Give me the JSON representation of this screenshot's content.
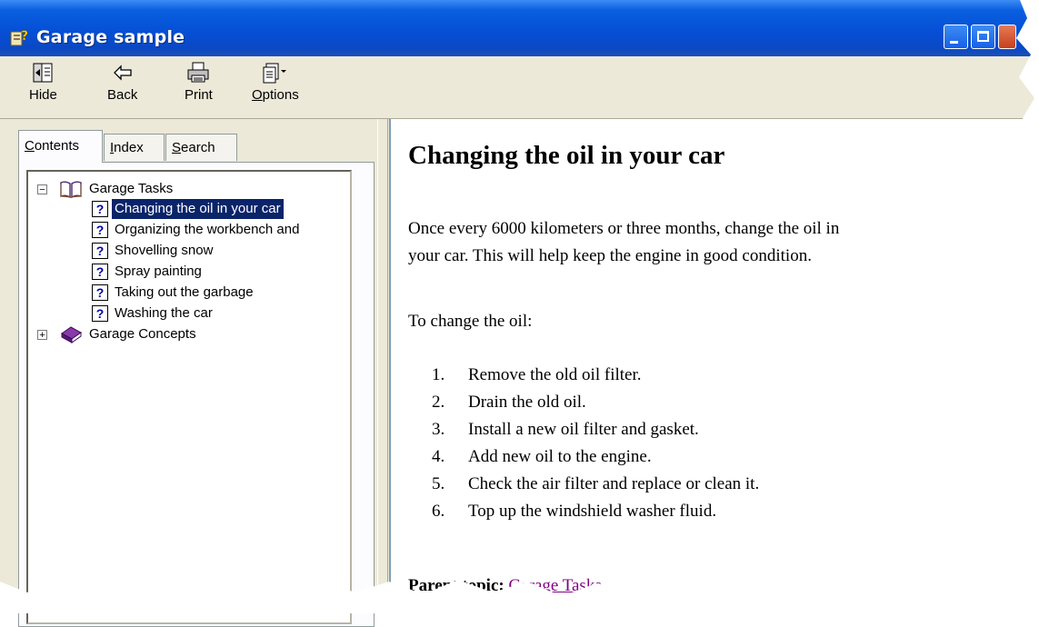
{
  "window": {
    "title": "Garage sample"
  },
  "toolbar": {
    "hide_label": "Hide",
    "back_label": "Back",
    "print_label": "Print",
    "options_label_pre": "",
    "options_label_ul": "O",
    "options_label_post": "ptions"
  },
  "tabs": {
    "contents_ul": "C",
    "contents_rest": "ontents",
    "index_ul": "I",
    "index_rest": "ndex",
    "search_ul": "S",
    "search_rest": "earch",
    "active": "Contents"
  },
  "tree": {
    "books": [
      {
        "label": "Garage Tasks",
        "expanded": true,
        "expander": "−"
      },
      {
        "label": "Garage Concepts",
        "expanded": false,
        "expander": "+"
      }
    ],
    "topics": [
      {
        "label": "Changing the oil in your car",
        "selected": true
      },
      {
        "label": "Organizing the workbench and",
        "selected": false
      },
      {
        "label": "Shovelling snow",
        "selected": false
      },
      {
        "label": "Spray painting",
        "selected": false
      },
      {
        "label": "Taking out the garbage",
        "selected": false
      },
      {
        "label": "Washing the car",
        "selected": false
      }
    ],
    "topic_icon": "?"
  },
  "content": {
    "heading": "Changing the oil in your car",
    "intro_line1": "Once every 6000 kilometers or three months, change the oil in",
    "intro_line2": "your car. This will help keep the engine in good condition.",
    "steps_intro": "To change the oil:",
    "steps": [
      {
        "num": "1.",
        "text": "Remove the old oil filter."
      },
      {
        "num": "2.",
        "text": "Drain the old oil."
      },
      {
        "num": "3.",
        "text": "Install a new oil filter and gasket."
      },
      {
        "num": "4.",
        "text": "Add new oil to the engine."
      },
      {
        "num": "5.",
        "text": "Check the air filter and replace or clean it."
      },
      {
        "num": "6.",
        "text": "Top up the windshield washer fluid."
      }
    ],
    "parent_label": "Parent topic:",
    "parent_link": "Garage Tasks"
  },
  "colors": {
    "titlebar": "#0550d6",
    "selection": "#0a246a",
    "visited_link": "#800080"
  }
}
